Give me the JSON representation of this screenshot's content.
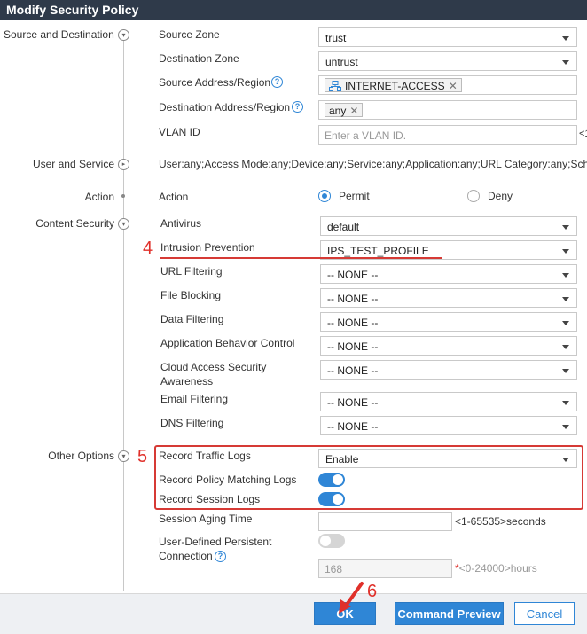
{
  "window": {
    "title": "Modify Security Policy"
  },
  "sections": {
    "source_destination": "Source and Destination",
    "user_service": "User and Service",
    "action": "Action",
    "content_security": "Content Security",
    "other_options": "Other Options"
  },
  "source_destination": {
    "source_zone": {
      "label": "Source Zone",
      "value": "trust"
    },
    "destination_zone": {
      "label": "Destination Zone",
      "value": "untrust"
    },
    "source_address": {
      "label": "Source Address/Region",
      "tag": "INTERNET-ACCESS"
    },
    "destination_address": {
      "label": "Destination Address/Region",
      "tag": "any"
    },
    "vlan_id": {
      "label": "VLAN ID",
      "placeholder": "Enter a VLAN ID.",
      "suffix": "<1"
    }
  },
  "user_service": {
    "summary": "User:any;Access Mode:any;Device:any;Service:any;Application:any;URL Category:any;Sch"
  },
  "action": {
    "label": "Action",
    "permit": "Permit",
    "deny": "Deny",
    "selected": "Permit"
  },
  "content_security": {
    "antivirus": {
      "label": "Antivirus",
      "value": "default"
    },
    "intrusion_prevention": {
      "label": "Intrusion Prevention",
      "value": "IPS_TEST_PROFILE"
    },
    "url_filtering": {
      "label": "URL Filtering",
      "value": "-- NONE --"
    },
    "file_blocking": {
      "label": "File Blocking",
      "value": "-- NONE --"
    },
    "data_filtering": {
      "label": "Data Filtering",
      "value": "-- NONE --"
    },
    "app_behavior": {
      "label": "Application Behavior Control",
      "value": "-- NONE --"
    },
    "cloud_access": {
      "label_line1": "Cloud Access Security",
      "label_line2": "Awareness",
      "value": "-- NONE --"
    },
    "email_filtering": {
      "label": "Email Filtering",
      "value": "-- NONE --"
    },
    "dns_filtering": {
      "label": "DNS Filtering",
      "value": "-- NONE --"
    }
  },
  "other_options": {
    "record_traffic_logs": {
      "label": "Record Traffic Logs",
      "value": "Enable"
    },
    "record_policy_matching_logs": {
      "label": "Record Policy Matching Logs",
      "on": true
    },
    "record_session_logs": {
      "label": "Record Session Logs",
      "on": true
    },
    "session_aging_time": {
      "label": "Session Aging Time",
      "value": "",
      "hint": "<1-65535>seconds"
    },
    "persistent_connection": {
      "label_line1": "User-Defined Persistent",
      "label_line2": "Connection",
      "on": false
    },
    "persistent_hours": {
      "value": "168",
      "star": "*",
      "hint": "<0-24000>hours"
    }
  },
  "annotations": {
    "step4": "4",
    "step5": "5",
    "step6": "6"
  },
  "footer": {
    "ok": "OK",
    "command_preview": "Command Preview",
    "cancel": "Cancel"
  },
  "colors": {
    "accent": "#2f86d6",
    "annotation": "#d63a35",
    "titlebar": "#2f3a4a"
  }
}
